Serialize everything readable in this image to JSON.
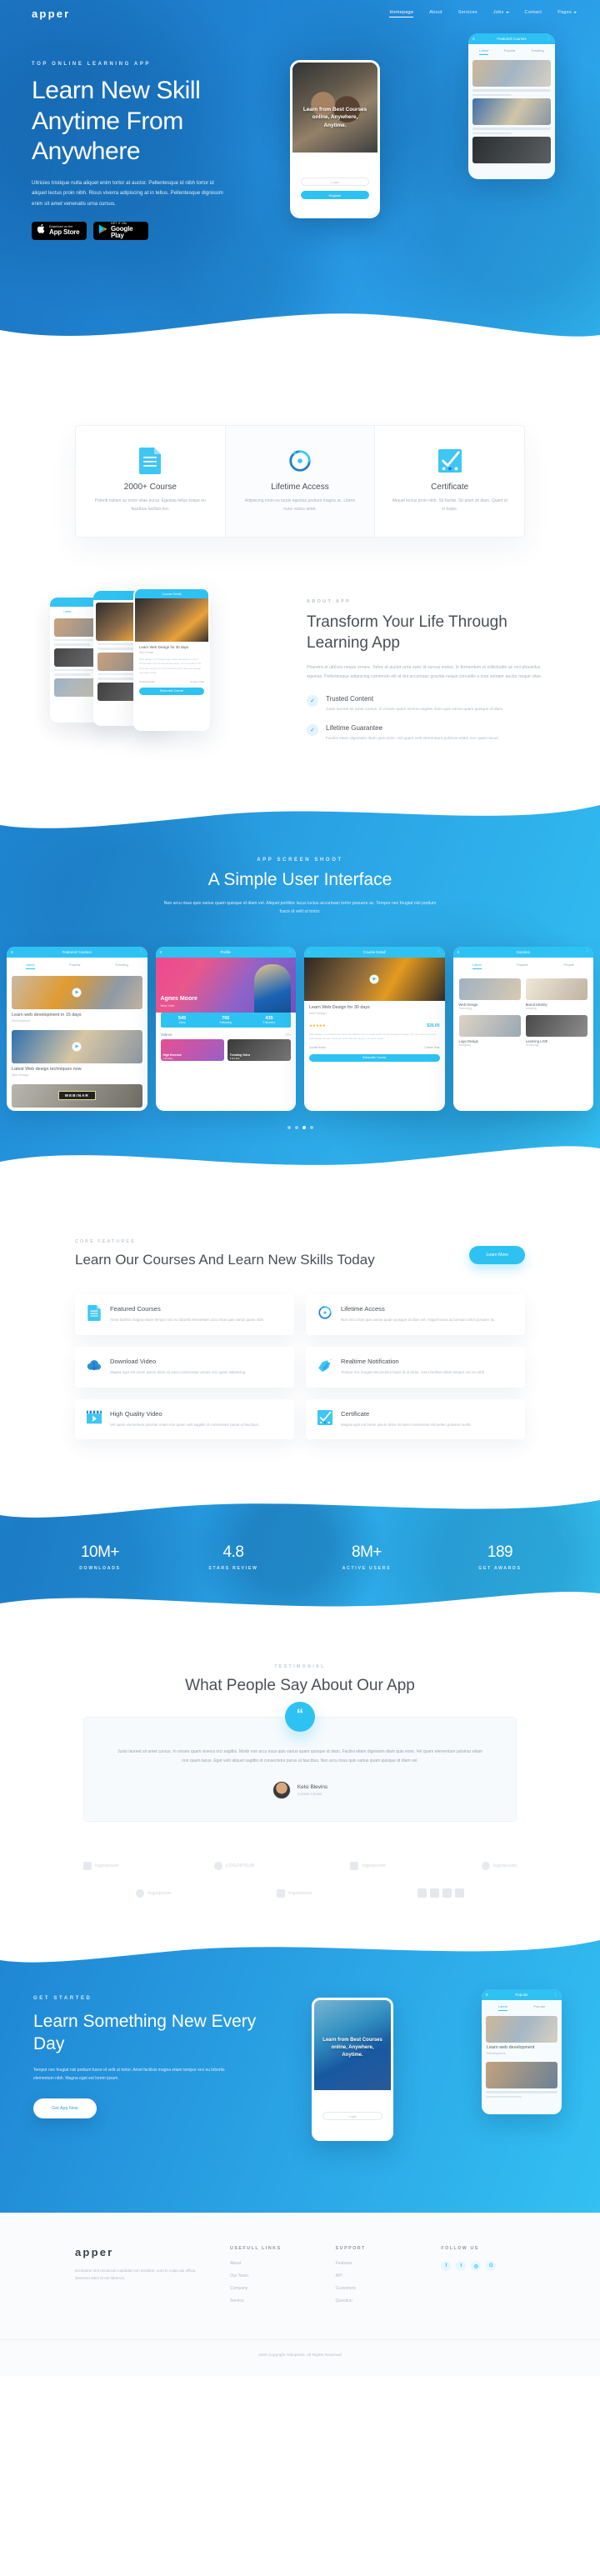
{
  "brand": {
    "name": "apper",
    "accent": "#2ec2f3",
    "primary": "#2188d8"
  },
  "nav": {
    "items": [
      {
        "label": "Homepage",
        "active": true,
        "caret": false
      },
      {
        "label": "About",
        "active": false,
        "caret": false
      },
      {
        "label": "Services",
        "active": false,
        "caret": false
      },
      {
        "label": "Jobs",
        "active": false,
        "caret": true
      },
      {
        "label": "Contact",
        "active": false,
        "caret": false
      },
      {
        "label": "Pages",
        "active": false,
        "caret": true
      }
    ]
  },
  "hero": {
    "eyebrow": "TOP ONLINE LEARNING APP",
    "title": "Learn New Skill Anytime From Anywhere",
    "text": "Ultricies tristique nulla aliquet enim tortor at auctor. Pellentesque id nibh tortor id aliquet lectus proin nibh. Risus viverra adipiscing at in tellus. Pellentesque dignissim enim sit amet venenatis urna cursus.",
    "appstore": {
      "small": "Download on the",
      "big": "App Store",
      "icon": "apple-icon"
    },
    "googleplay": {
      "small": "GET IT ON",
      "big": "Google Play",
      "icon": "google-play-icon"
    },
    "phone_back": {
      "title": "Featured Courses",
      "tabs": [
        "Latest",
        "Popular",
        "Trending"
      ]
    },
    "phone_front": {
      "caption": "Learn from Best Courses online, Anywhere, Anytime.",
      "login_placeholder": "Login",
      "register_label": "Register"
    }
  },
  "features3": [
    {
      "icon": "document-icon",
      "title": "2000+ Course",
      "text": "Potenti nullam ac tortor vitae purus. Egestas tellus esque eu faucibus facilisis leo."
    },
    {
      "icon": "refresh-clock-icon",
      "title": "Lifetime Access",
      "text": "Adipiscing enim eu turpis egestas pretium magna ac. Libero nunc varius amet."
    },
    {
      "icon": "certificate-check-icon",
      "title": "Certificate",
      "text": "Aliquet lectus proin nibh. Sit facilisi. Sit amet sit diam. Quam id in turpis."
    }
  ],
  "about": {
    "eyebrow": "ABOUT APP",
    "title": "Transform Your Life Through Learning App",
    "lead": "Pharetra et ultrices neque ornare. Tortor at auctor urna nunc id cursus metus. In fermentum et sollicitudin ac orci phasellus egestas. Pellentesque adipiscing commodo elit at dui accumsan gravida neque convallis a cras semper auctor neque vitae.",
    "points": [
      {
        "icon": "check-circle-icon",
        "title": "Trusted Content",
        "text": "Justo laoreet sit amet cursus. In ornare quam viverra sagittis risus quis varius quam quisque id diam."
      },
      {
        "icon": "check-circle-icon",
        "title": "Lifetime Guarantee",
        "text": "Facilisi etiam dignissim diam quis enim. Vel quam velit elementum pulvinar etiam non quam lacus."
      }
    ],
    "card_bar_title": "Course Detail",
    "card_tabs": [
      "Latest",
      "Popular",
      "Trending"
    ],
    "card_course_title": "Learn Web Design for 30 days",
    "card_course_sub": "Web Design",
    "card_body": "Web design is a broad-scope field that defines how a visual asset can be developed today. You can select the best web design for your business and make the design you want inside.",
    "card_author": "Course Author",
    "card_time": "Course Time",
    "card_btn": "Subscribe Course"
  },
  "screens": {
    "eyebrow": "APP SCREEN SHOOT",
    "title": "A Simple User Interface",
    "text": "Non arcu risus quis varius quam quisque id diam vel. Aliquet porttitor lacus luctus accumsan tortor posuere ac. Tempor nec feugiat nisl pretium fusce id velit ut tortor.",
    "cards": [
      {
        "bar": "Featured Courses",
        "tabs": [
          "Latest",
          "Popular",
          "Trending"
        ],
        "items": [
          {
            "title": "Learn web development in 15 days",
            "sub": "Development"
          },
          {
            "title": "Latest Web design techniques now",
            "sub": "Web Design"
          }
        ],
        "webinar_label": "WEBINAR"
      },
      {
        "bar": "Profile",
        "name": "Agnes Moore",
        "location": "New York",
        "stats": [
          {
            "n": "545",
            "l": "Likes"
          },
          {
            "n": "766",
            "l": "Following"
          },
          {
            "n": "435",
            "l": "Followers"
          }
        ],
        "videos_label": "Videos",
        "videos": [
          {
            "title": "High Exercise",
            "likes": "1.1k Likes"
          },
          {
            "title": "Trending Video",
            "likes": "3.3k Likes"
          }
        ]
      },
      {
        "bar": "Course Detail",
        "title": "Learn Web Design for 30 days",
        "sub": "Web Design",
        "price": "$35.00",
        "rating": "★★★★★",
        "body": "Web design is a broad-scope field that defines how a visual asset can be developed today. You can select the best web design for your business and make the design you want inside.",
        "author_label": "Course Author",
        "time_label": "Course Time",
        "btn": "Subscribe Course"
      },
      {
        "bar": "Courses",
        "tabs": [
          "Latest",
          "Popular",
          "People"
        ],
        "items": [
          {
            "title": "Web Design",
            "sub": "Technology"
          },
          {
            "title": "Brand Identity",
            "sub": "Branding"
          },
          {
            "title": "Logo Design",
            "sub": "Designing"
          },
          {
            "title": "Learning LIVE",
            "sub": "Technology"
          }
        ]
      }
    ],
    "dots": 4,
    "active_dot": 2
  },
  "core": {
    "eyebrow": "CORE FEATURES",
    "title": "Learn Our Courses And Learn New Skills Today",
    "button": "Learn More",
    "cards": [
      {
        "icon": "document-icon",
        "title": "Featured Courses",
        "text": "Amet facilisis magna etiam tempor orci eu lobortis elementum arcu risus quis varius quam nibh."
      },
      {
        "icon": "refresh-clock-icon",
        "title": "Lifetime Access",
        "text": "Non arcu risus quis varius quam quisque id diam vel. Aliquet lacus accumsan tortor posuere ac."
      },
      {
        "icon": "cloud-download-icon",
        "title": "Download Video",
        "text": "Magna eget est lorem ipsum dolor sit amet consectetur ornare orci quam adipiscing."
      },
      {
        "icon": "notification-tag-icon",
        "title": "Realtime Notification",
        "text": "Tempor nec feugiat nisl pretium fusce id ut tortor. Amet facilisis etiam tempor orci eu nibh."
      },
      {
        "icon": "video-player-icon",
        "title": "High Quality Video",
        "text": "Vel quam elementum pulvinar etiam non quam velit sagittis id consectetur purus ut faucibus."
      },
      {
        "icon": "certificate-check-icon",
        "title": "Certificate",
        "text": "Magna eget est lorem ipsum dolor sit amet consectetur elit pellen pulvinar morbi."
      }
    ]
  },
  "chart_data": {
    "type": "bar",
    "title": "App Key Metrics",
    "categories": [
      "DOWNLOADS",
      "STARS REVIEW",
      "ACTIVE USERS",
      "GET AWARDS"
    ],
    "values": [
      10000000,
      4.8,
      8000000,
      189
    ],
    "display_values": [
      "10M+",
      "4.8",
      "8M+",
      "189"
    ],
    "xlabel": "",
    "ylabel": "",
    "legend": "none",
    "grid": false
  },
  "stats": [
    {
      "n": "10M+",
      "l": "DOWNLOADS"
    },
    {
      "n": "4.8",
      "l": "STARS REVIEW"
    },
    {
      "n": "8M+",
      "l": "ACTIVE USERS"
    },
    {
      "n": "189",
      "l": "GET AWARDS"
    }
  ],
  "testimonial": {
    "eyebrow": "TESTIMONIAL",
    "title": "What People Say About Our App",
    "quote_mark": "“",
    "text": "Justo laoreet sit amet cursus. In ornare quam viverra orci sagittis. Morbi non arcu risus quis varius quam quisque id diam. Facilisi etiam dignissim diam quis enim. Vel quam elementum pulvinar etiam non quam lacus. Eget velit aliquet sagittis id consectetur purus ut faucibus. Non arcu risus quis varius quam quisque id diam vel.",
    "author": "Kelsi Blevins",
    "role": "Content Creator"
  },
  "logos": {
    "row1": [
      "logoipsum",
      "LOGOIPSUM",
      "logoipsum",
      "logoipsum"
    ],
    "row2": [
      "logoipsum",
      "logoipsum"
    ]
  },
  "cta": {
    "eyebrow": "GET STARTED",
    "title": "Learn Something New Every Day",
    "text": "Tempor nec feugiat nisl pretium fusce id velit ut tortor. Amet facilisis magna etiam tempor orci eu lobortis elementum nibh. Magna eget est lorem ipsum.",
    "button": "Get App Now",
    "phone_caption": "Learn from Best Courses online, Anywhere, Anytime.",
    "login_placeholder": "Login",
    "card_bar": "Popular",
    "card_tabs": [
      "Latest",
      "Popular"
    ],
    "card_item_title": "Learn web development",
    "card_item_sub": "Development"
  },
  "footer": {
    "logo": "apper",
    "about": "Excepteur sint occaecat cupidatat non proident, sunt in culpa qui officia deserunt anim id est laborum.",
    "col1": {
      "title": "USEFULL LINKS",
      "links": [
        "About",
        "Our Team",
        "Company",
        "Service"
      ]
    },
    "col2": {
      "title": "SUPPORT",
      "links": [
        "Features",
        "API",
        "Customers",
        "Question"
      ]
    },
    "col3": {
      "title": "FOLLOW US",
      "socials": [
        "facebook-icon",
        "twitter-icon",
        "instagram-icon",
        "google-plus-icon"
      ]
    },
    "copyright": "2020 Copyright Tokopress. All Rights Reserved"
  }
}
